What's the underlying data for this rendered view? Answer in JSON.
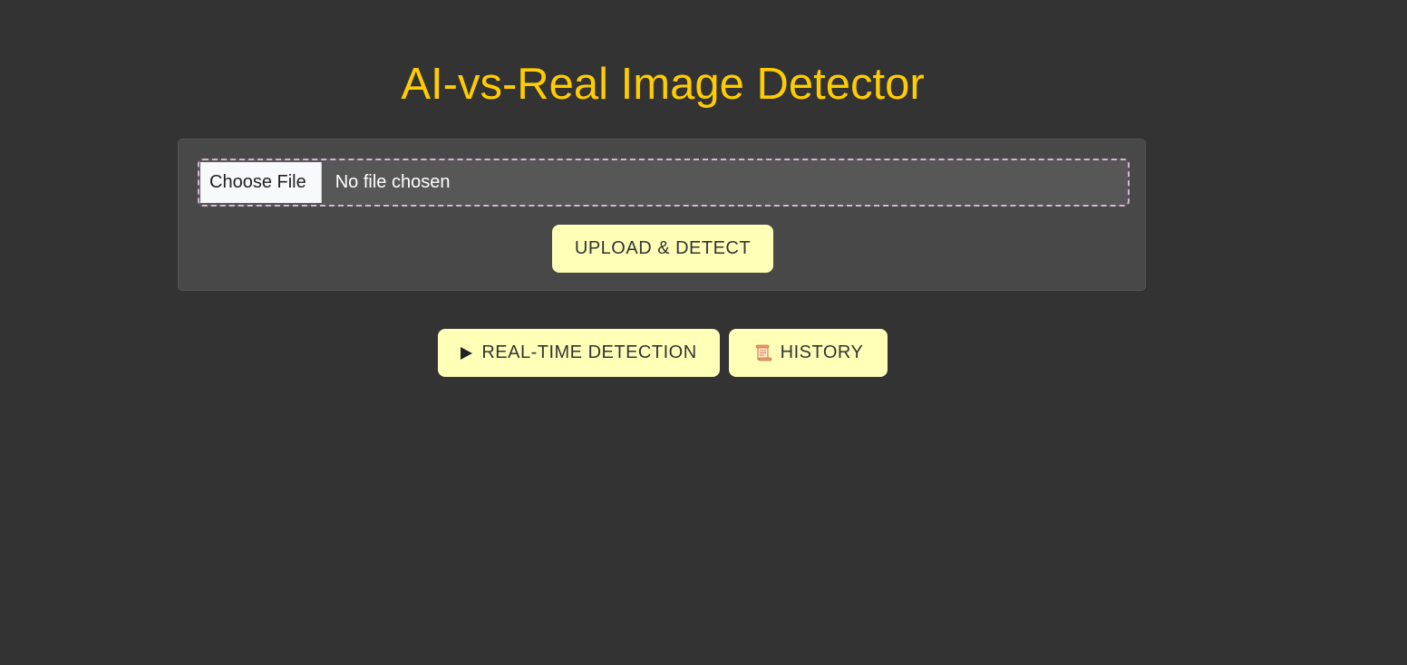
{
  "header": {
    "title": "AI-vs-Real Image Detector"
  },
  "upload": {
    "choose_file_label": "Choose File",
    "file_status": "No file chosen",
    "upload_button_label": "UPLOAD & DETECT"
  },
  "actions": {
    "realtime_label": "REAL-TIME DETECTION",
    "realtime_icon": "play-icon",
    "history_label": "HISTORY",
    "history_icon": "scroll-icon"
  },
  "colors": {
    "background": "#333333",
    "card": "#484848",
    "title": "#ffcc00",
    "button": "#ffffb8",
    "dashed_border": "#d7b4d7"
  }
}
